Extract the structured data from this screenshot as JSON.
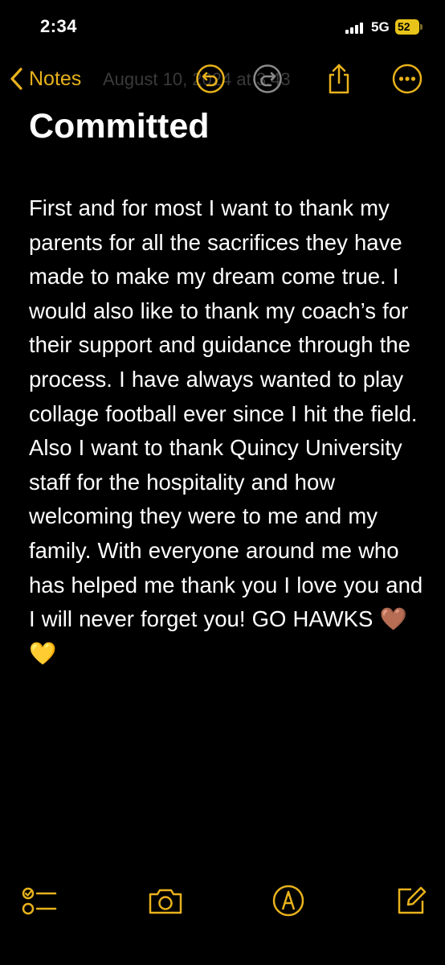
{
  "status_bar": {
    "time": "2:34",
    "network": "5G",
    "battery": "52"
  },
  "nav": {
    "back_label": "Notes",
    "faded_date": "August 10, 2024 at 3:43",
    "icons": [
      "undo-icon",
      "redo-icon",
      "share-icon",
      "more-icon"
    ],
    "accent_color": "#e8b21c"
  },
  "note": {
    "title": "Committed",
    "body": "      First and for most I want to thank my parents for all the sacrifices they have made to make my dream come true. I would also like to thank my coach’s for their support and guidance through the process. I have always wanted to play collage football ever since I hit the field. Also I want to thank Quincy University staff for the hospitality and how welcoming they were to me and my family.  With everyone around me who has helped me thank you I love you and I will never forget you!     GO HAWKS 🤎💛"
  },
  "toolbar": {
    "icons": [
      "checklist-icon",
      "camera-icon",
      "markup-icon",
      "compose-icon"
    ]
  }
}
